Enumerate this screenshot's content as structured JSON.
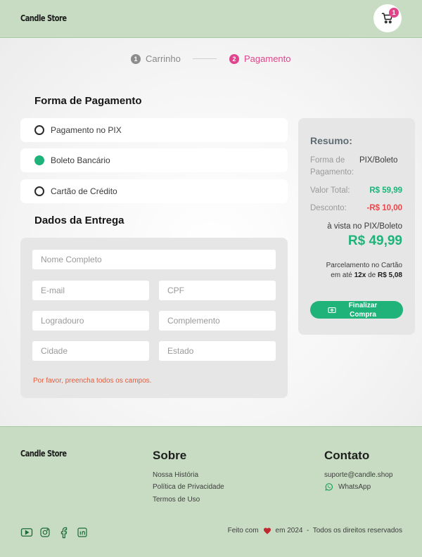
{
  "header": {
    "logo": "Candle Store",
    "cart_count": "1"
  },
  "stepper": {
    "step1": {
      "num": "1",
      "label": "Carrinho"
    },
    "step2": {
      "num": "2",
      "label": "Pagamento"
    }
  },
  "payment": {
    "title": "Forma de Pagamento",
    "options": [
      {
        "label": "Pagamento no PIX",
        "selected": false
      },
      {
        "label": "Boleto Bancário",
        "selected": true
      },
      {
        "label": "Cartão de Crédito",
        "selected": false
      }
    ]
  },
  "delivery": {
    "title": "Dados da Entrega",
    "fields": {
      "name": "Nome Completo",
      "email": "E-mail",
      "cpf": "CPF",
      "street": "Logradouro",
      "complement": "Complemento",
      "city": "Cidade",
      "state": "Estado"
    },
    "error": "Por favor, preencha todos os campos."
  },
  "summary": {
    "title": "Resumo:",
    "payment_label": "Forma de Pagamento:",
    "payment_value": "PIX/Boleto",
    "total_label": "Valor Total:",
    "total_value": "R$ 59,99",
    "discount_label": "Desconto:",
    "discount_value": "-R$ 10,00",
    "pix_label": "à vista no PIX/Boleto",
    "pix_value": "R$ 49,99",
    "install_line1": "Parcelamento no Cartão",
    "install_prefix": "em até",
    "install_times": "12x",
    "install_mid": "de",
    "install_value": "R$ 5,08",
    "finish_button": "Finalizar Compra"
  },
  "footer": {
    "logo": "Candle Store",
    "about_title": "Sobre",
    "about_links": [
      "Nossa História",
      "Política de Privacidade",
      "Termos de Uso"
    ],
    "contact_title": "Contato",
    "contact_email": "suporte@candle.shop",
    "contact_whatsapp": "WhatsApp",
    "copy_prefix": "Feito com",
    "copy_suffix": "em 2024  -  Todos os direitos reservados"
  },
  "colors": {
    "header_bg": "#c7dcc2",
    "accent_green": "#1fb37a",
    "accent_pink": "#e0458c",
    "discount_red": "#e5484d"
  },
  "icons": {
    "cart": "shopping-cart-icon",
    "youtube": "youtube-icon",
    "instagram": "instagram-icon",
    "facebook": "facebook-icon",
    "linkedin": "linkedin-icon",
    "whatsapp": "whatsapp-icon",
    "heart": "heart-icon",
    "money": "money-bill-icon"
  }
}
